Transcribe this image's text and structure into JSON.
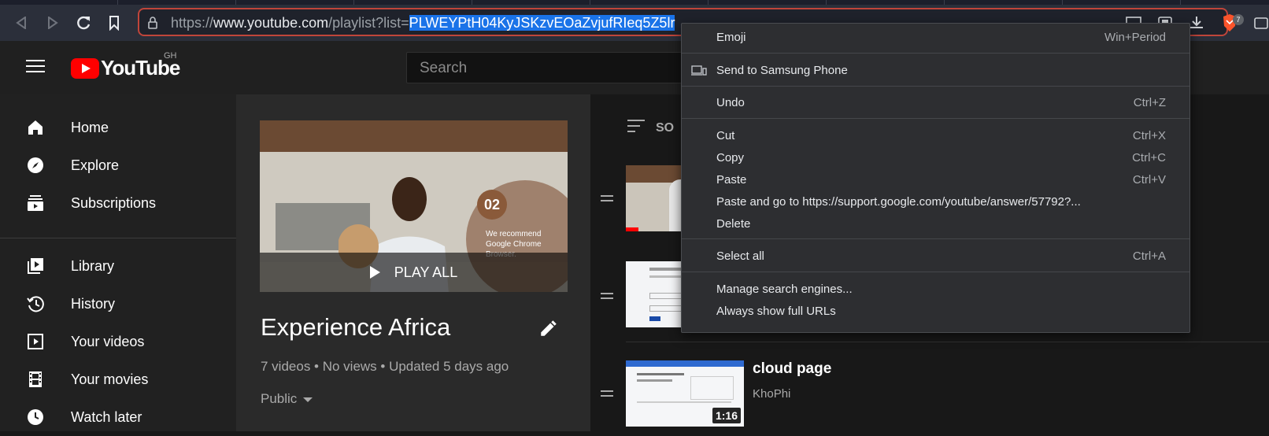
{
  "browser": {
    "url_prefix": "https://",
    "url_host": "www.youtube.com",
    "url_path": "/playlist?list=",
    "url_selected": "PLWEYPtH04KyJSKzvEOaZvjufRIeq5Z5lr",
    "brave_badge": "7"
  },
  "header": {
    "logo_text": "YouTube",
    "country_code": "GH",
    "search_placeholder": "Search"
  },
  "sidebar": {
    "items": [
      {
        "label": "Home",
        "icon": "home-icon"
      },
      {
        "label": "Explore",
        "icon": "compass-icon"
      },
      {
        "label": "Subscriptions",
        "icon": "subscriptions-icon"
      },
      {
        "label": "Library",
        "icon": "library-icon"
      },
      {
        "label": "History",
        "icon": "history-icon"
      },
      {
        "label": "Your videos",
        "icon": "your-videos-icon"
      },
      {
        "label": "Your movies",
        "icon": "film-icon"
      },
      {
        "label": "Watch later",
        "icon": "clock-icon"
      }
    ]
  },
  "playlist": {
    "thumbnail_number": "02",
    "thumbnail_text": "We recommend Google Chrome Browser.",
    "play_all": "PLAY ALL",
    "title": "Experience Africa",
    "stats": "7 videos • No views • Updated 5 days ago",
    "privacy": "Public"
  },
  "list": {
    "sort_label": "SO",
    "videos": [
      {
        "title": "",
        "channel": "",
        "duration": ""
      },
      {
        "title": "",
        "channel": "",
        "duration": ""
      },
      {
        "title": "cloud page",
        "channel": "KhoPhi",
        "duration": "1:16"
      }
    ]
  },
  "context_menu": {
    "items": [
      {
        "label": "Emoji",
        "shortcut": "Win+Period"
      },
      {
        "label": "Send to Samsung Phone",
        "shortcut": "",
        "icon": "devices-icon"
      },
      {
        "label": "Undo",
        "shortcut": "Ctrl+Z"
      },
      {
        "label": "Cut",
        "shortcut": "Ctrl+X"
      },
      {
        "label": "Copy",
        "shortcut": "Ctrl+C"
      },
      {
        "label": "Paste",
        "shortcut": "Ctrl+V"
      },
      {
        "label": "Paste and go to https://support.google.com/youtube/answer/57792?...",
        "shortcut": ""
      },
      {
        "label": "Delete",
        "shortcut": ""
      },
      {
        "label": "Select all",
        "shortcut": "Ctrl+A"
      },
      {
        "label": "Manage search engines...",
        "shortcut": ""
      },
      {
        "label": "Always show full URLs",
        "shortcut": ""
      }
    ]
  },
  "colors": {
    "accent_red": "#ff0000",
    "selection_blue": "#1a73e8",
    "omnibox_border": "#c0453a"
  }
}
